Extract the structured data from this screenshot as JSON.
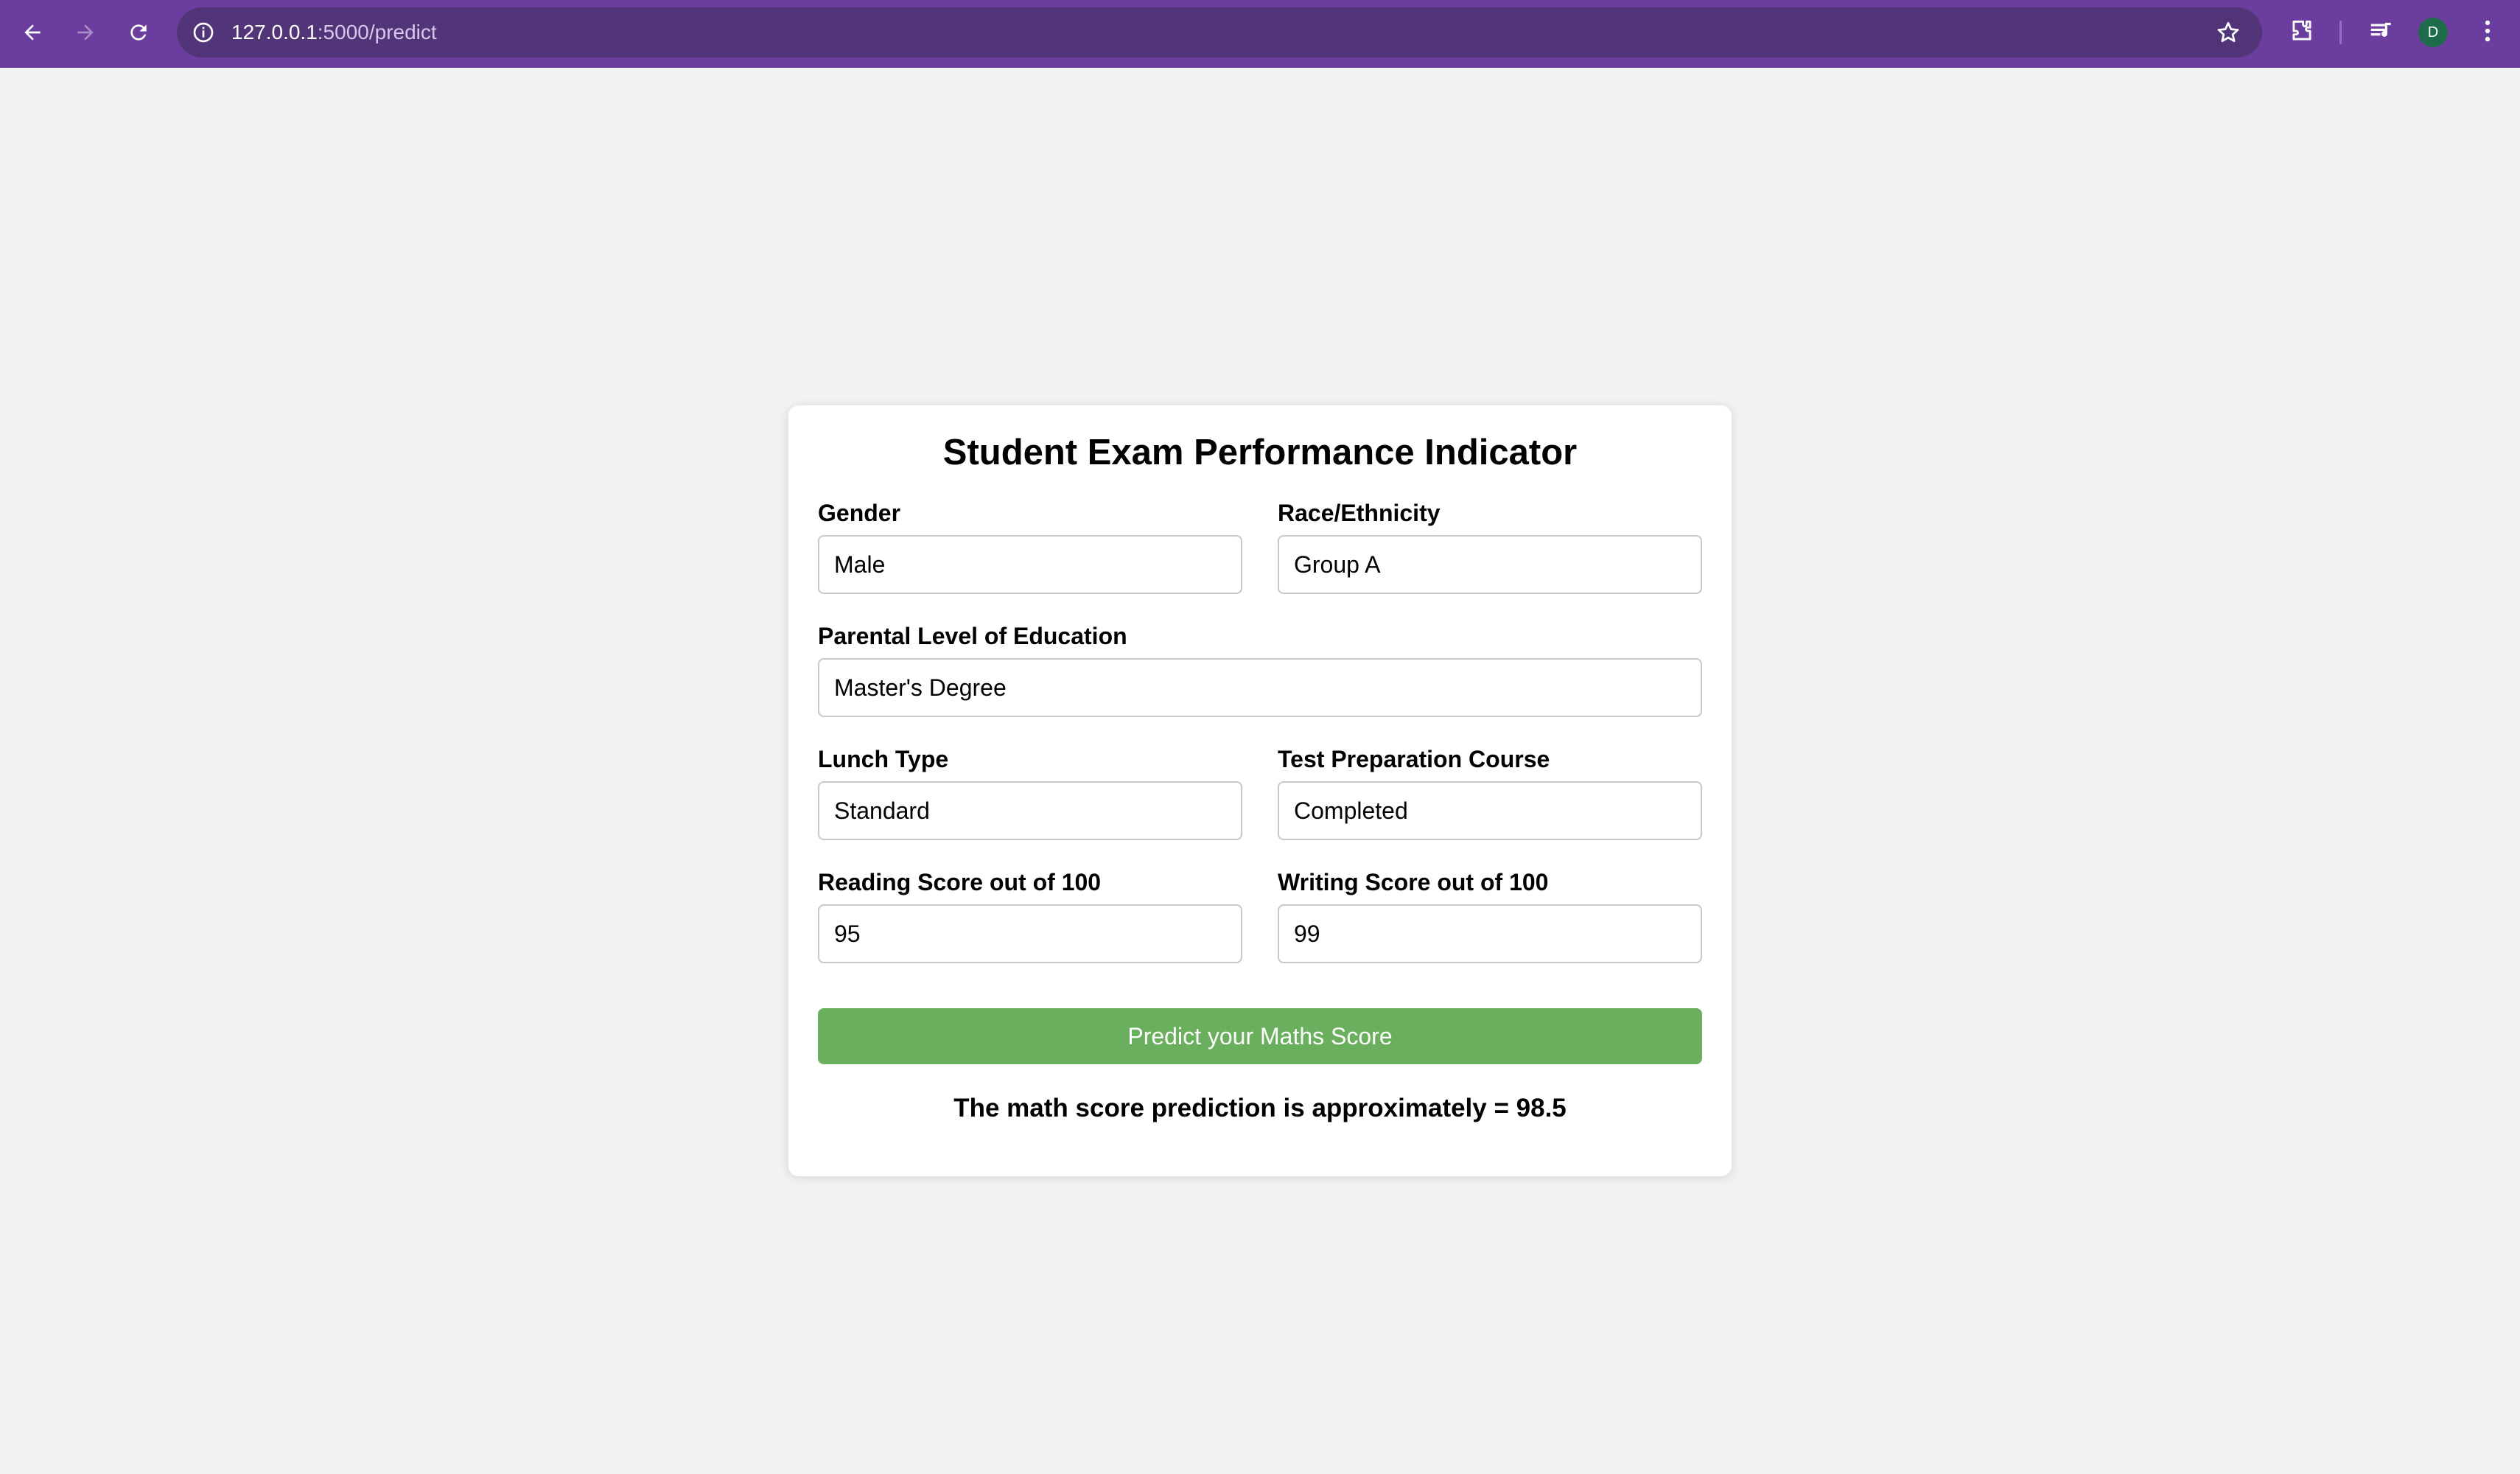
{
  "browser": {
    "url_host": "127.0.0.1",
    "url_path": ":5000/predict",
    "profile_initial": "D",
    "icons": {
      "back": "arrow-left-icon",
      "forward": "arrow-right-icon",
      "reload": "reload-icon",
      "site_info": "info-icon",
      "bookmark": "star-icon",
      "extensions": "puzzle-icon",
      "media": "media-queue-icon",
      "menu": "kebab-menu-icon"
    },
    "colors": {
      "toolbar": "#6a3d9e",
      "omnibox": "#523578",
      "avatar": "#1e6b4a"
    }
  },
  "form": {
    "title": "Student Exam Performance Indicator",
    "fields": {
      "gender": {
        "label": "Gender",
        "value": "Male"
      },
      "race": {
        "label": "Race/Ethnicity",
        "value": "Group A"
      },
      "education": {
        "label": "Parental Level of Education",
        "value": "Master's Degree"
      },
      "lunch": {
        "label": "Lunch Type",
        "value": "Standard"
      },
      "test_prep": {
        "label": "Test Preparation Course",
        "value": "Completed"
      },
      "reading": {
        "label": "Reading Score out of 100",
        "value": "95"
      },
      "writing": {
        "label": "Writing Score out of 100",
        "value": "99"
      }
    },
    "submit_label": "Predict your Maths Score",
    "result_text": "The math score prediction is approximately = 98.5",
    "colors": {
      "button": "#6aaf5d",
      "page_background": "#f2f2f2"
    }
  }
}
